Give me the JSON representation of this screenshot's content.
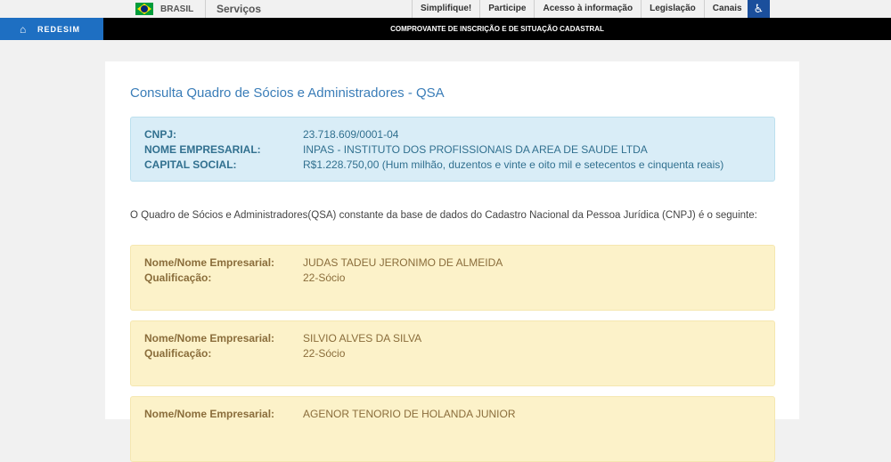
{
  "govbar": {
    "country_label": "BRASIL",
    "services_label": "Serviços",
    "links": [
      "Simplifique!",
      "Participe",
      "Acesso à informação",
      "Legislação",
      "Canais"
    ],
    "accessibility_icon": "accessibility-icon"
  },
  "header": {
    "logo_text": "REDESIM",
    "title": "COMPROVANTE DE INSCRIÇÃO E DE SITUAÇÃO CADASTRAL"
  },
  "main": {
    "title": "Consulta Quadro de Sócios e Administradores - QSA",
    "company": {
      "cnpj_label": "CNPJ:",
      "cnpj_value": "23.718.609/0001-04",
      "name_label": "NOME EMPRESARIAL:",
      "name_value": "INPAS - INSTITUTO DOS PROFISSIONAIS DA AREA DE SAUDE LTDA",
      "capital_label": "CAPITAL SOCIAL:",
      "capital_value": "R$1.228.750,00 (Hum milhão, duzentos e vinte e oito mil e setecentos e cinquenta reais)"
    },
    "intro_text": "O Quadro de Sócios e Administradores(QSA) constante da base de dados do Cadastro Nacional da Pessoa Jurídica (CNPJ) é o seguinte:",
    "partner_name_label": "Nome/Nome Empresarial:",
    "partner_role_label": "Qualificação:",
    "partners": [
      {
        "name": "JUDAS TADEU JERONIMO DE ALMEIDA",
        "role": "22-Sócio"
      },
      {
        "name": "SILVIO ALVES DA SILVA",
        "role": "22-Sócio"
      },
      {
        "name": "AGENOR TENORIO DE HOLANDA JUNIOR",
        "role": ""
      }
    ]
  },
  "colors": {
    "header_bg": "#000000",
    "logo_bg": "#1e6fc2",
    "title": "#3a7db8",
    "info_bg": "#d9edf7",
    "partner_bg": "#fcf2c9"
  }
}
